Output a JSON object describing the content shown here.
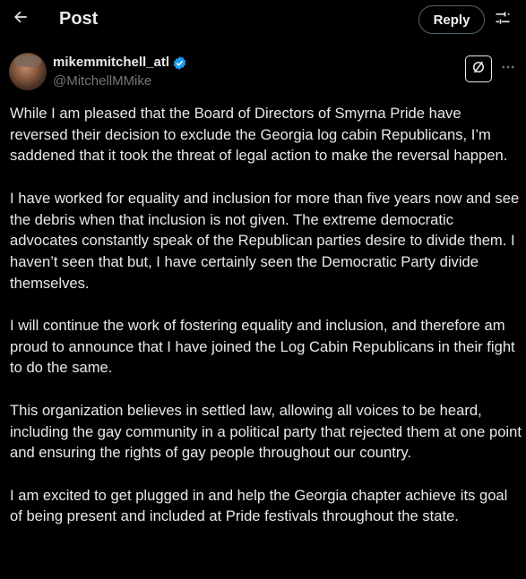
{
  "header": {
    "title": "Post",
    "reply_label": "Reply",
    "icons": {
      "back": "back-arrow-icon",
      "filter": "sliders-icon"
    }
  },
  "author": {
    "display_name": "mikemmitchell_atl",
    "handle": "@MitchellMMike",
    "verified": true,
    "verified_color": "#1d9bf0"
  },
  "actions": {
    "grok_icon": "grok-icon",
    "more_icon": "more-icon"
  },
  "tweet": {
    "paragraphs": [
      "While I am pleased that the Board of Directors of Smyrna Pride have reversed their decision to exclude the Georgia log cabin Republicans, I’m saddened that it took the threat of legal action to make the reversal happen.",
      "I have worked for equality and inclusion for more than five years now and see the debris when that inclusion is not given.  The extreme democratic advocates constantly speak of the Republican parties desire to divide them. I haven’t seen that but, I have certainly seen the Democratic Party divide themselves.",
      "I will continue the work of fostering equality and inclusion, and therefore am proud to announce that I have joined the Log Cabin Republicans in their fight to do the same.",
      "This organization believes in settled law, allowing all voices to be heard, including the gay community in a political party that rejected them at one point and ensuring the rights of gay people throughout our country.",
      "I am excited to get plugged in and help the Georgia chapter achieve its goal of being present and included at Pride festivals throughout the state."
    ]
  },
  "colors": {
    "background": "#000000",
    "text": "#e7e9ea",
    "secondary": "#71767b",
    "border": "#536471"
  }
}
